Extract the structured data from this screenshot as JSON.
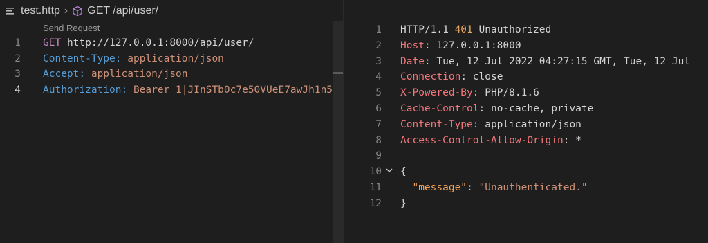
{
  "breadcrumb": {
    "file": "test.http",
    "symbol": "GET /api/user/"
  },
  "codelens": "Send Request",
  "request": {
    "lines": [
      {
        "num": "1",
        "parts": [
          {
            "t": "GET",
            "c": "kw-method"
          },
          {
            "t": " ",
            "c": "plain"
          },
          {
            "t": "http://127.0.0.1:8000/api/user/",
            "c": "url"
          }
        ]
      },
      {
        "num": "2",
        "parts": [
          {
            "t": "Content-Type:",
            "c": "hdr-blue"
          },
          {
            "t": " ",
            "c": "plain"
          },
          {
            "t": "application/json",
            "c": "val-orange"
          }
        ]
      },
      {
        "num": "3",
        "parts": [
          {
            "t": "Accept:",
            "c": "hdr-blue"
          },
          {
            "t": " ",
            "c": "plain"
          },
          {
            "t": "application/json",
            "c": "val-orange"
          }
        ]
      },
      {
        "num": "4",
        "parts": [
          {
            "t": "Authorization:",
            "c": "hdr-blue"
          },
          {
            "t": " ",
            "c": "plain"
          },
          {
            "t": "Bearer 1|JInSTb0c7e50VUeE7awJh1n5",
            "c": "val-orange"
          }
        ]
      }
    ]
  },
  "response": {
    "lines": [
      {
        "num": "1",
        "parts": [
          {
            "t": "HTTP/1.1 ",
            "c": "plain"
          },
          {
            "t": "401",
            "c": "status-num"
          },
          {
            "t": " Unauthorized",
            "c": "plain"
          }
        ]
      },
      {
        "num": "2",
        "parts": [
          {
            "t": "Host",
            "c": "resp-key"
          },
          {
            "t": ": 127.0.0.1:8000",
            "c": "plain"
          }
        ]
      },
      {
        "num": "3",
        "parts": [
          {
            "t": "Date",
            "c": "resp-key"
          },
          {
            "t": ": Tue, 12 Jul 2022 04:27:15 GMT, Tue, 12 Jul",
            "c": "plain"
          }
        ]
      },
      {
        "num": "4",
        "parts": [
          {
            "t": "Connection",
            "c": "resp-key"
          },
          {
            "t": ": close",
            "c": "plain"
          }
        ]
      },
      {
        "num": "5",
        "parts": [
          {
            "t": "X-Powered-By",
            "c": "resp-key"
          },
          {
            "t": ": PHP/8.1.6",
            "c": "plain"
          }
        ]
      },
      {
        "num": "6",
        "parts": [
          {
            "t": "Cache-Control",
            "c": "resp-key"
          },
          {
            "t": ": no-cache, private",
            "c": "plain"
          }
        ]
      },
      {
        "num": "7",
        "parts": [
          {
            "t": "Content-Type",
            "c": "resp-key"
          },
          {
            "t": ": application/json",
            "c": "plain"
          }
        ]
      },
      {
        "num": "8",
        "parts": [
          {
            "t": "Access-Control-Allow-Origin",
            "c": "resp-key"
          },
          {
            "t": ": *",
            "c": "plain"
          }
        ]
      },
      {
        "num": "9",
        "parts": []
      },
      {
        "num": "10",
        "parts": [
          {
            "t": "{",
            "c": "plain"
          }
        ]
      },
      {
        "num": "11",
        "parts": [
          {
            "t": "  ",
            "c": "plain"
          },
          {
            "t": "\"message\"",
            "c": "json-key"
          },
          {
            "t": ": ",
            "c": "plain"
          },
          {
            "t": "\"Unauthenticated.\"",
            "c": "json-str"
          }
        ]
      },
      {
        "num": "12",
        "parts": [
          {
            "t": "}",
            "c": "plain"
          }
        ]
      }
    ]
  },
  "colors": {
    "background": "#1e1e1e",
    "method": "#c586c0",
    "header_name": "#569cd6",
    "header_value": "#ce9178",
    "response_key": "#f2777a",
    "status_code": "#e5a45c"
  }
}
